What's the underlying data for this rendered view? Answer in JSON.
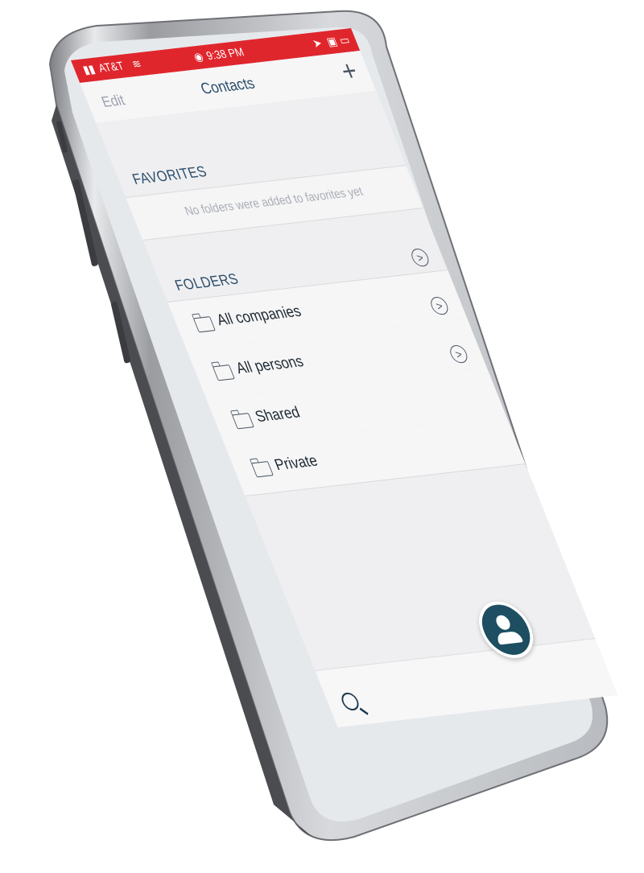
{
  "status_bar": {
    "carrier": "AT&T",
    "time": "9:38 PM"
  },
  "nav": {
    "edit_label": "Edit",
    "title": "Contacts",
    "add_symbol": "+"
  },
  "favorites": {
    "heading": "FAVORITES",
    "empty_message": "No folders were added to favorites yet"
  },
  "folders": {
    "heading": "FOLDERS",
    "items": [
      {
        "label": "All companies"
      },
      {
        "label": "All persons"
      },
      {
        "label": "Shared"
      },
      {
        "label": "Private"
      }
    ]
  },
  "colors": {
    "status_bar": "#e0262d",
    "accent": "#2b4d6a",
    "fab": "#1d4e62"
  },
  "icons": {
    "search": "search-icon",
    "add": "plus-icon",
    "folder": "folder-icon",
    "chevron": "chevron-right-circle-icon",
    "contact": "person-icon"
  }
}
